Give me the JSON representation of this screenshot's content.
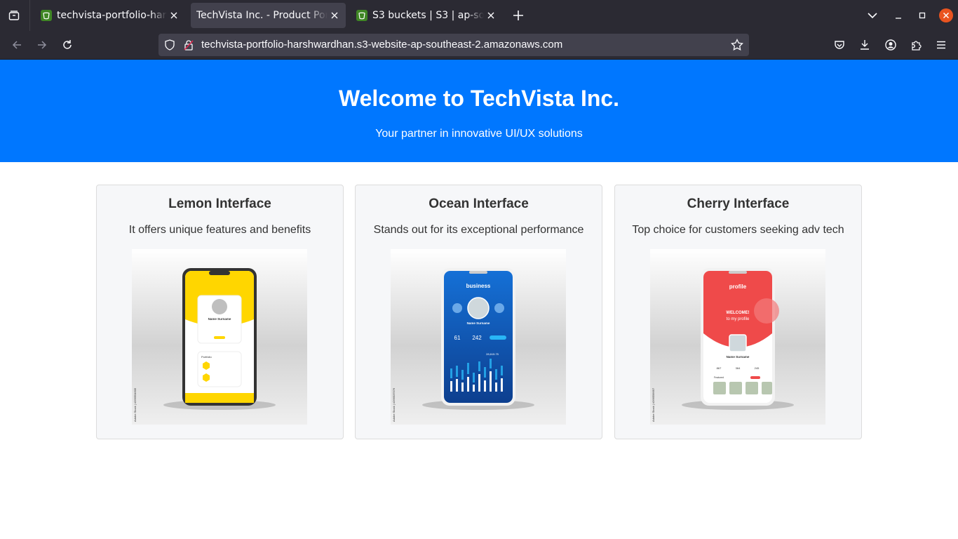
{
  "browser": {
    "tabs": [
      {
        "title": "techvista-portfolio-harshwardhan.s3-website",
        "active": false
      },
      {
        "title": "TechVista Inc. - Product Portfolio",
        "active": true
      },
      {
        "title": "S3 buckets | S3 | ap-southeast-2",
        "active": false
      }
    ],
    "url": "techvista-portfolio-harshwardhan.s3-website-ap-southeast-2.amazonaws.com"
  },
  "hero": {
    "title": "Welcome to TechVista Inc.",
    "subtitle": "Your partner in innovative UI/UX solutions",
    "background": "#0077ff"
  },
  "cards": [
    {
      "title": "Lemon Interface",
      "description": "It offers unique features and benefits",
      "accent": "#ffd600"
    },
    {
      "title": "Ocean Interface",
      "description": "Stands out for its exceptional performance",
      "accent": "#1570d6"
    },
    {
      "title": "Cherry Interface",
      "description": "Top choice for customers seeking adv tech",
      "accent": "#ef4a4a"
    }
  ],
  "phone_screens": {
    "lemon": {
      "name": "Name Surname",
      "section": "Portfolio",
      "watermark": "Adobe Stock | #266554605"
    },
    "ocean": {
      "header": "business",
      "name": "Name Surname",
      "stat1": "61",
      "stat2": "242",
      "amount": "28,615.75",
      "watermark": "Adobe Stock | #266537576"
    },
    "cherry": {
      "header": "profile",
      "welcome": "WELCOME!",
      "welcome_sub": "to my profile",
      "name": "Name Surname",
      "stat1": "867",
      "stat2": "364",
      "stat3": "245",
      "featured": "Featured",
      "watermark": "Adobe Stock | #266556697"
    }
  }
}
